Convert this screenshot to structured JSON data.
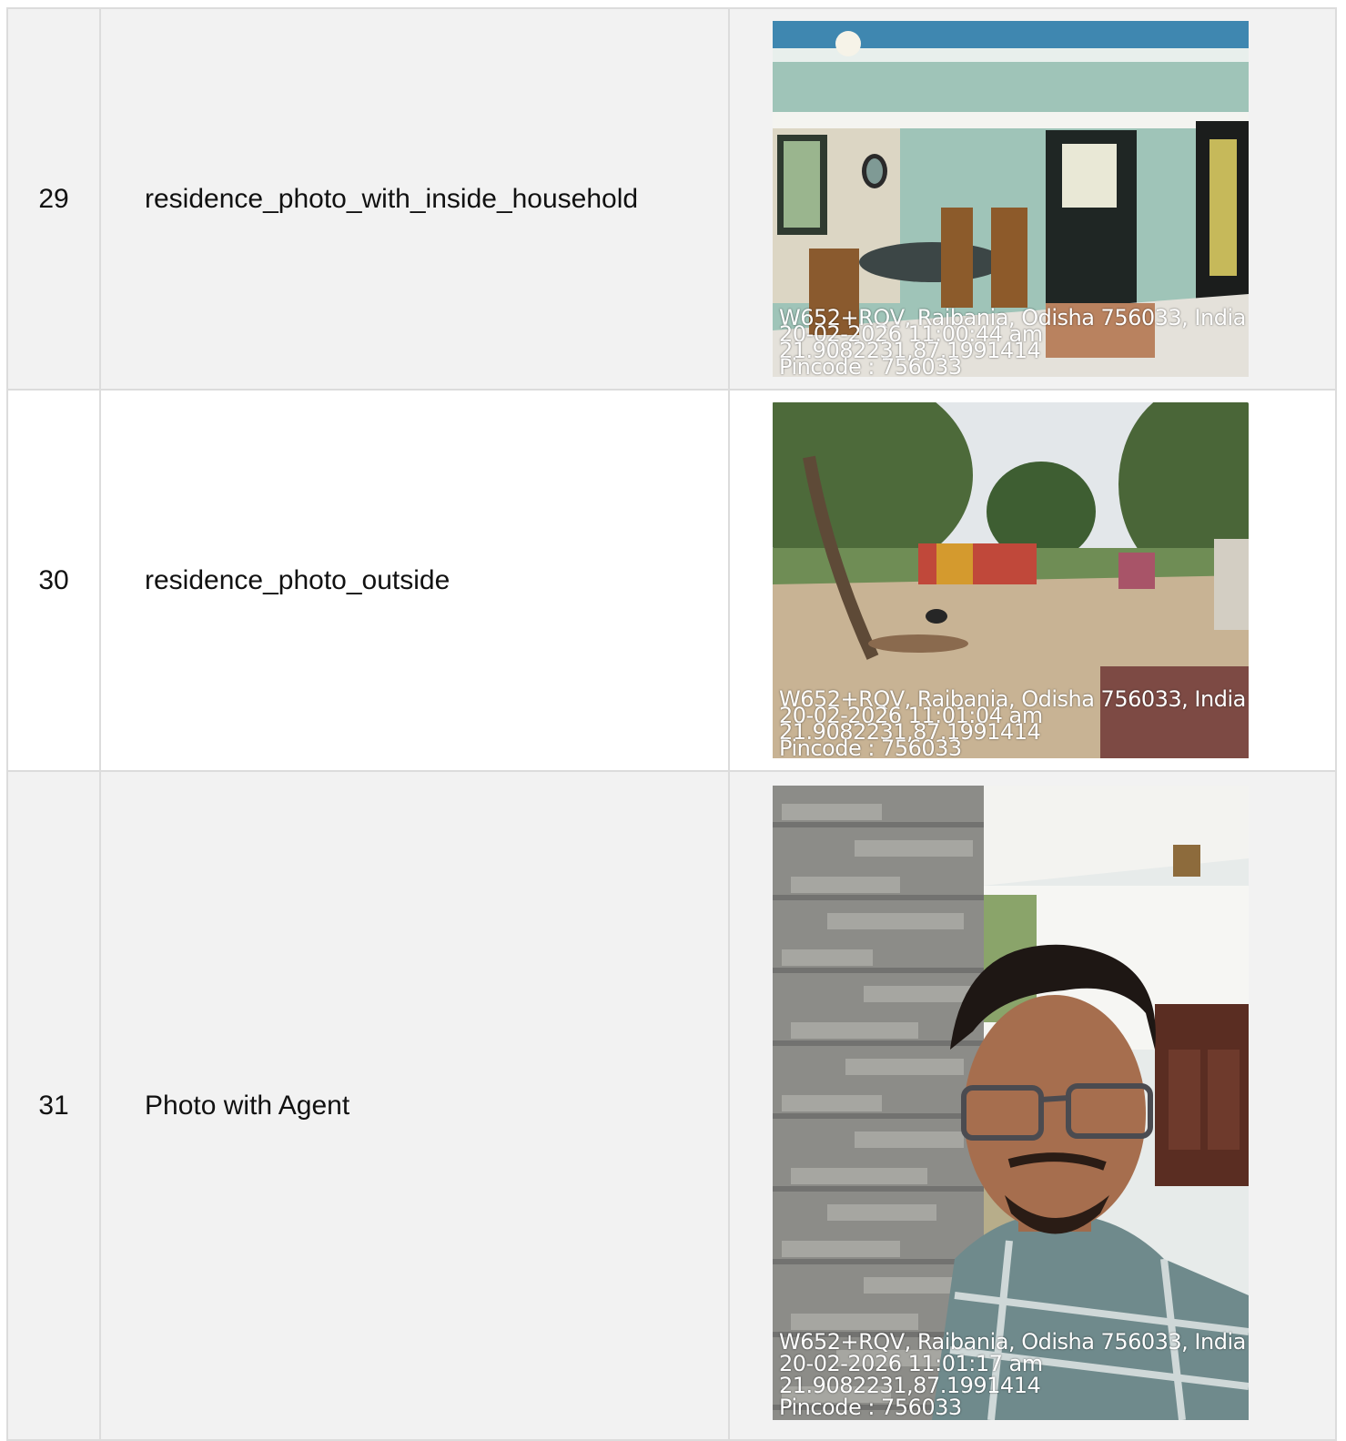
{
  "rows": [
    {
      "number": "29",
      "label": "residence_photo_with_inside_household",
      "stamp": {
        "line1": "W652+RQV, Raibania, Odisha 756033, India",
        "line2": "20-02-2026 11:00:44 am",
        "line3": "21.9082231,87.1991414",
        "line4": "Pincode : 756033"
      }
    },
    {
      "number": "30",
      "label": "residence_photo_outside",
      "stamp": {
        "line1": "W652+RQV, Raibania, Odisha 756033, India",
        "line2": "20-02-2026 11:01:04 am",
        "line3": "21.9082231,87.1991414",
        "line4": "Pincode : 756033"
      }
    },
    {
      "number": "31",
      "label": "Photo with Agent",
      "stamp": {
        "line1": "W652+RQV, Raibania, Odisha 756033, India",
        "line2": "20-02-2026 11:01:17 am",
        "line3": "21.9082231,87.1991414",
        "line4": "Pincode : 756033"
      }
    }
  ]
}
